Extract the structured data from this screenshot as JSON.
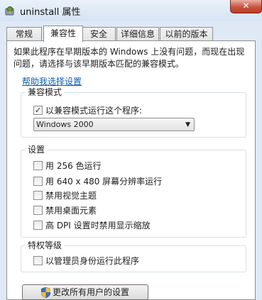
{
  "window": {
    "title": "uninstall 属性",
    "close_glyph": "✕"
  },
  "tabs": [
    {
      "label": "常规",
      "active": false
    },
    {
      "label": "兼容性",
      "active": true
    },
    {
      "label": "安全",
      "active": false
    },
    {
      "label": "详细信息",
      "active": false
    },
    {
      "label": "以前的版本",
      "active": false
    }
  ],
  "intro_text": "如果此程序在早期版本的 Windows 上没有问题，而现在出现问题，请选择与该早期版本匹配的兼容模式。",
  "help_link": "帮助我选择设置",
  "compat_group": {
    "title": "兼容模式",
    "checkbox_label": "以兼容模式运行这个程序:",
    "checked": true,
    "selected_os": "Windows 2000"
  },
  "settings_group": {
    "title": "设置",
    "items": [
      {
        "label": "用 256 色运行",
        "checked": false
      },
      {
        "label": "用 640 x 480 屏幕分辨率运行",
        "checked": false
      },
      {
        "label": "禁用视觉主题",
        "checked": false
      },
      {
        "label": "禁用桌面元素",
        "checked": false
      },
      {
        "label": "高 DPI 设置时禁用显示缩放",
        "checked": false
      }
    ]
  },
  "privilege_group": {
    "title": "特权等级",
    "checkbox_label": "以管理员身份运行此程序",
    "checked": false
  },
  "bottom_button": "更改所有用户的设置",
  "colors": {
    "link": "#0a5fb4",
    "close_button": "#c9543f",
    "window_frame": "#dfe9f5"
  },
  "icons": {
    "app": "uninstall-app-icon",
    "shield": "uac-shield-icon",
    "dropdown": "chevron-down-icon"
  }
}
